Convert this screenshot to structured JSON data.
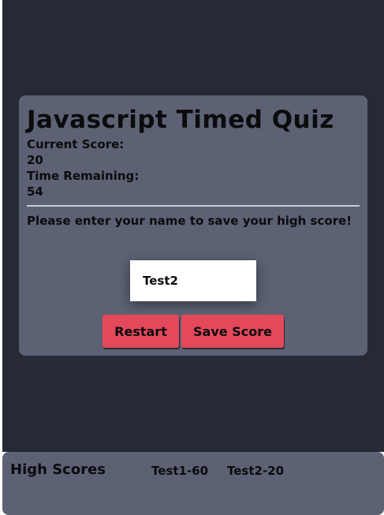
{
  "quiz": {
    "title": "Javascript Timed Quiz",
    "score_label": "Current Score:",
    "score_value": "20",
    "time_label": "Time Remaining:",
    "time_value": "54",
    "prompt": "Please enter your name to save your high score!",
    "name_input_value": "Test2",
    "restart_label": "Restart",
    "save_label": "Save Score"
  },
  "footer": {
    "title": "High Scores",
    "scores": [
      "Test1-60",
      "Test2-20"
    ]
  },
  "colors": {
    "page_bg": "#262a35",
    "card_bg": "#5c6273",
    "button_bg": "#e5485a",
    "text": "#0b0b0e"
  }
}
